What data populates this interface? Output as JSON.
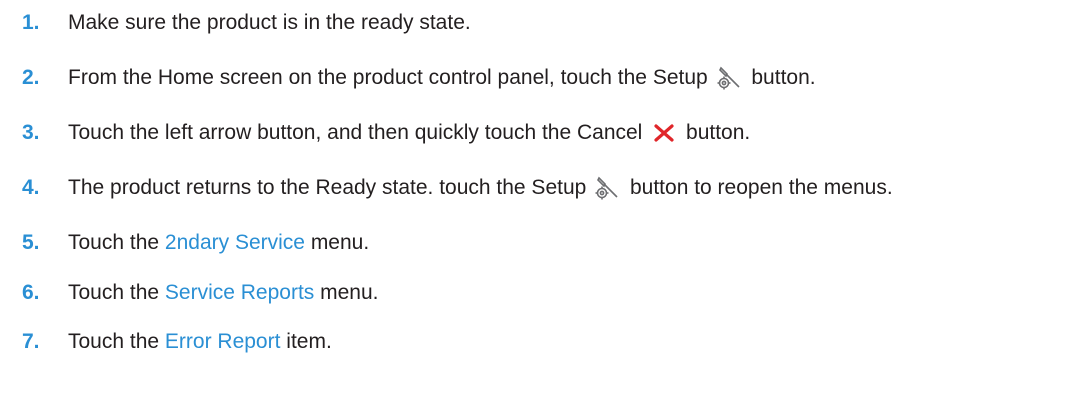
{
  "steps": [
    {
      "number": "1.",
      "parts": [
        "Make sure the product is in the ready state."
      ]
    },
    {
      "number": "2.",
      "before": "From the Home screen on the product control panel, touch the Setup ",
      "icon": "setup-wrench-gear-icon",
      "after": " button."
    },
    {
      "number": "3.",
      "before": "Touch the left arrow button, and then quickly touch the Cancel ",
      "icon": "cancel-x-icon",
      "after": " button."
    },
    {
      "number": "4.",
      "before": "The product returns to the Ready state. touch the Setup ",
      "icon": "setup-wrench-gear-icon",
      "after": " button to reopen the menus."
    },
    {
      "number": "5.",
      "before": "Touch the ",
      "link": "2ndary Service",
      "after": " menu."
    },
    {
      "number": "6.",
      "before": "Touch the ",
      "link": "Service Reports",
      "after": " menu."
    },
    {
      "number": "7.",
      "before": "Touch the ",
      "link": "Error Report",
      "after": " item."
    }
  ],
  "colors": {
    "step_number": "#2a8fd4",
    "link": "#2a8fd4",
    "text": "#231f20",
    "cancel_icon": "#e0262a",
    "setup_icon": "#6d6e71"
  }
}
